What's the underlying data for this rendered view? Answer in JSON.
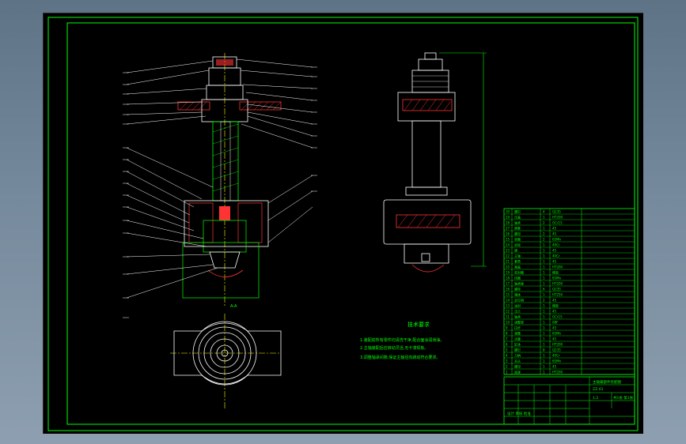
{
  "colors": {
    "background": "#000000",
    "frame": "#00ff00",
    "outline": "#ffffff",
    "hatch": "#ff3333",
    "centerline": "#ffff00",
    "text": "#00ff00",
    "window": "#6f8397"
  },
  "notes": {
    "title": "技术要求",
    "lines": [
      "1.装配前所有零件均清洗干净,配合面涂润滑油。",
      "2.主轴装配后应转动灵活,无卡滞现象。",
      "3.调整轴承间隙,保证主轴径向跳动符合要求。"
    ]
  },
  "title_block": {
    "title": "主轴箱部件装配图",
    "drawing_no": "ZZ-01",
    "scale": "1:2",
    "sheet": "共1张 第1张",
    "signature": "设计 审核 批准"
  },
  "view_labels": {
    "left_bottom": "A-A"
  },
  "parts_list": [
    {
      "no": "30",
      "name": "螺钉",
      "qty": "4",
      "material": "Q235"
    },
    {
      "no": "29",
      "name": "压盖",
      "qty": "1",
      "material": "HT200"
    },
    {
      "no": "28",
      "name": "轴承",
      "qty": "2",
      "material": "GCr15"
    },
    {
      "no": "27",
      "name": "隔套",
      "qty": "1",
      "material": "45"
    },
    {
      "no": "26",
      "name": "螺母",
      "qty": "2",
      "material": "45"
    },
    {
      "no": "25",
      "name": "垫圈",
      "qty": "2",
      "material": "65Mn"
    },
    {
      "no": "24",
      "name": "齿轮",
      "qty": "1",
      "material": "40Cr"
    },
    {
      "no": "23",
      "name": "键",
      "qty": "1",
      "material": "45"
    },
    {
      "no": "22",
      "name": "主轴",
      "qty": "1",
      "material": "40Cr"
    },
    {
      "no": "21",
      "name": "套筒",
      "qty": "1",
      "material": "45"
    },
    {
      "no": "20",
      "name": "端盖",
      "qty": "1",
      "material": "HT200"
    },
    {
      "no": "19",
      "name": "密封圈",
      "qty": "1",
      "material": "橡胶"
    },
    {
      "no": "18",
      "name": "挡圈",
      "qty": "1",
      "material": "65Mn"
    },
    {
      "no": "17",
      "name": "轴承座",
      "qty": "1",
      "material": "HT200"
    },
    {
      "no": "16",
      "name": "螺栓",
      "qty": "6",
      "material": "Q235"
    },
    {
      "no": "15",
      "name": "箱体",
      "qty": "1",
      "material": "HT250"
    },
    {
      "no": "14",
      "name": "定位销",
      "qty": "2",
      "material": "45"
    },
    {
      "no": "13",
      "name": "油封",
      "qty": "1",
      "material": "橡胶"
    },
    {
      "no": "12",
      "name": "法兰",
      "qty": "1",
      "material": "45"
    },
    {
      "no": "11",
      "name": "轴承",
      "qty": "1",
      "material": "GCr15"
    },
    {
      "no": "10",
      "name": "调整垫",
      "qty": "1",
      "material": "08F"
    },
    {
      "no": "9",
      "name": "拉杆",
      "qty": "1",
      "material": "45"
    },
    {
      "no": "8",
      "name": "弹簧",
      "qty": "1",
      "material": "65Mn"
    },
    {
      "no": "7",
      "name": "活塞",
      "qty": "1",
      "material": "45"
    },
    {
      "no": "6",
      "name": "缸体",
      "qty": "1",
      "material": "HT200"
    },
    {
      "no": "5",
      "name": "螺钉",
      "qty": "8",
      "material": "Q235"
    },
    {
      "no": "4",
      "name": "刀柄",
      "qty": "1",
      "material": "40Cr"
    },
    {
      "no": "3",
      "name": "夹头",
      "qty": "1",
      "material": "65Mn"
    },
    {
      "no": "2",
      "name": "螺母",
      "qty": "1",
      "material": "45"
    },
    {
      "no": "1",
      "name": "底座",
      "qty": "1",
      "material": "HT200"
    }
  ]
}
